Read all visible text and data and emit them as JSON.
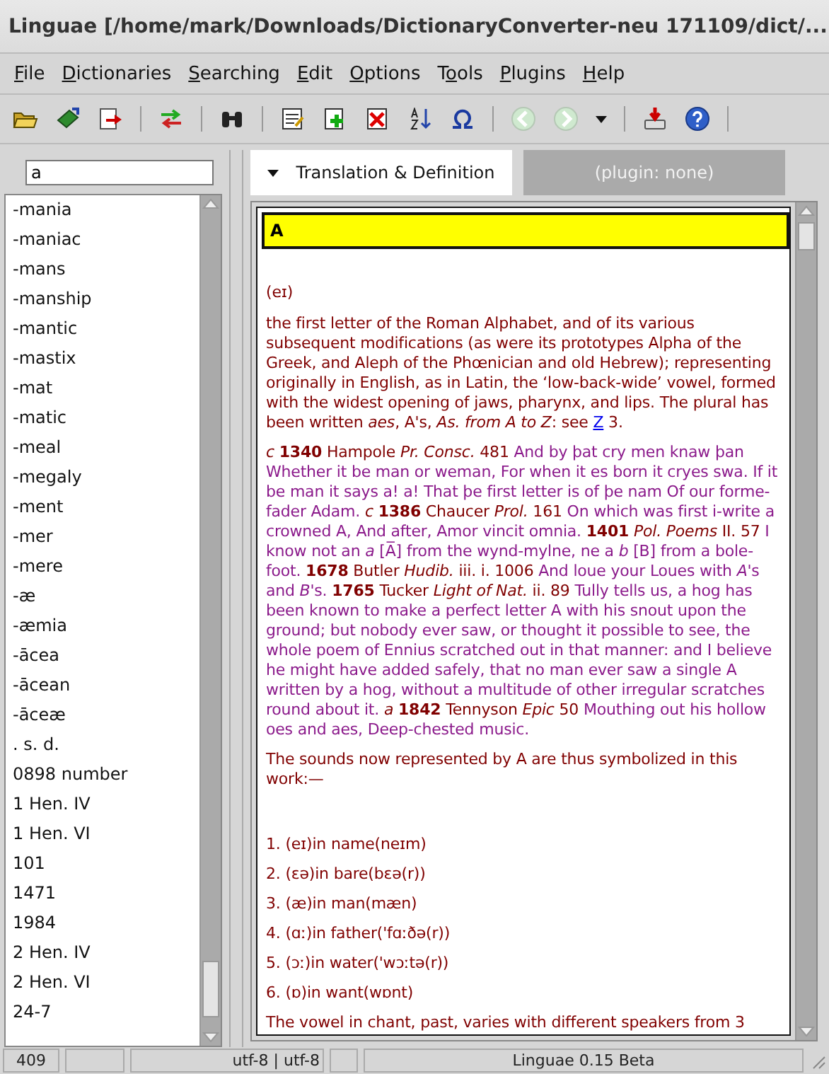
{
  "window": {
    "title": "Linguae [/home/mark/Downloads/DictionaryConverter-neu 171109/dict/..."
  },
  "menu": [
    {
      "key": "F",
      "rest": "ile"
    },
    {
      "key": "D",
      "rest": "ictionaries"
    },
    {
      "key": "S",
      "rest": "earching"
    },
    {
      "key": "E",
      "rest": "dit"
    },
    {
      "key": "O",
      "rest": "ptions"
    },
    {
      "pre": "T",
      "key": "o",
      "rest": "ols"
    },
    {
      "key": "P",
      "rest": "lugins"
    },
    {
      "key": "H",
      "rest": "elp"
    }
  ],
  "search": {
    "value": "a"
  },
  "word_list": [
    "-mania",
    "-maniac",
    "-mans",
    "-manship",
    "-mantic",
    "-mastix",
    "-mat",
    "-matic",
    "-meal",
    "-megaly",
    "-ment",
    "-mer",
    "-mere",
    "-æ",
    "-æmia",
    "-ācea",
    "-ācean",
    "-āceæ",
    ". s. d.",
    "0898 number",
    "1 Hen. IV",
    "1 Hen. VI",
    "101",
    "1471",
    "1984",
    "2 Hen. IV",
    "2 Hen. VI",
    "24-7"
  ],
  "tabs": [
    {
      "label": "Translation & Definition",
      "selected": true
    },
    {
      "label": "(plugin: none)",
      "selected": false
    }
  ],
  "entry": {
    "headword": "A",
    "blocks": [
      {
        "kind": "pron",
        "segments": [
          {
            "kind": "text",
            "text": "(eɪ)"
          }
        ]
      },
      {
        "kind": "para",
        "segments": [
          {
            "kind": "text",
            "text": "the first letter of the Roman Alphabet, and of its various subsequent modifications (as were its prototypes Alpha of the Greek, and Aleph of the Phœnician and old Hebrew); representing originally in English, as in Latin, the ‘low-back-wide’ vowel, formed with the widest opening of jaws, pharynx, and lips. The plural has been written *aes*, A's, *As. from A to Z*: see "
          },
          {
            "kind": "link",
            "text": "Z"
          },
          {
            "kind": "text",
            "text": " 3."
          }
        ]
      },
      {
        "kind": "para",
        "segments": [
          {
            "kind": "ref",
            "text": "*c* **1340** Hampole *Pr. Consc.* 481"
          },
          {
            "kind": "quote",
            "text": " And by þat cry men knaw þan Whether it be man or weman, For when it es born it cryes swa. If it be man it says a! a! That þe first letter is of þe nam Of our forme-fader Adam. "
          },
          {
            "kind": "ref",
            "text": "*c* **1386** Chaucer *Prol.* 161"
          },
          {
            "kind": "quote",
            "text": " On which was first i-write a crowned A, And after, Amor vincit omnia. "
          },
          {
            "kind": "ref",
            "text": "**1401** *Pol. Poems* II. 57"
          },
          {
            "kind": "quote",
            "text": " I know not an *a* [A̅] from the wynd-mylne, ne a *b* [B] from a bole-foot. "
          },
          {
            "kind": "ref",
            "text": "**1678** Butler *Hudib.* iii. i. 1006"
          },
          {
            "kind": "quote",
            "text": " And loue your Loues with *A*'s and *B*'s. "
          },
          {
            "kind": "ref",
            "text": "**1765** Tucker *Light of Nat.* ii. 89"
          },
          {
            "kind": "quote",
            "text": " Tully tells us, a hog has been known to make a perfect letter A with his snout upon the ground; but nobody ever saw, or thought it possible to see, the whole poem of Ennius scratched out in that manner: and I believe he might have added safely, that no man ever saw a single A written by a hog, without a multitude of other irregular scratches round about it. "
          },
          {
            "kind": "ref",
            "text": "*a* **1842** Tennyson *Epic* 50"
          },
          {
            "kind": "quote",
            "text": " Mouthing out his hollow oes and aes, Deep-chested music."
          }
        ]
      },
      {
        "kind": "para",
        "segments": [
          {
            "kind": "text",
            "text": "The sounds now represented by A are thus symbolized in this work:—"
          }
        ]
      },
      {
        "kind": "item",
        "segments": [
          {
            "kind": "text",
            "text": "1. (eɪ)in name(neɪm)"
          }
        ]
      },
      {
        "kind": "item",
        "segments": [
          {
            "kind": "text",
            "text": "2. (ɛə)in bare(bɛə(r))"
          }
        ]
      },
      {
        "kind": "item",
        "segments": [
          {
            "kind": "text",
            "text": "3. (æ)in man(mæn)"
          }
        ]
      },
      {
        "kind": "item",
        "segments": [
          {
            "kind": "text",
            "text": "4. (ɑː)in father('fɑːðə(r))"
          }
        ]
      },
      {
        "kind": "item",
        "segments": [
          {
            "kind": "text",
            "text": "5. (ɔː)in water('wɔːtə(r))"
          }
        ]
      },
      {
        "kind": "item",
        "segments": [
          {
            "kind": "text",
            "text": "6. (ɒ)in want(wɒnt)"
          }
        ]
      },
      {
        "kind": "para",
        "segments": [
          {
            "kind": "text",
            "text": "The vowel in chant, past, varies with different speakers from 3"
          }
        ]
      }
    ]
  },
  "status_bar": {
    "count": "409",
    "encoding": "utf-8 | utf-8",
    "version": "Linguae 0.15 Beta"
  }
}
